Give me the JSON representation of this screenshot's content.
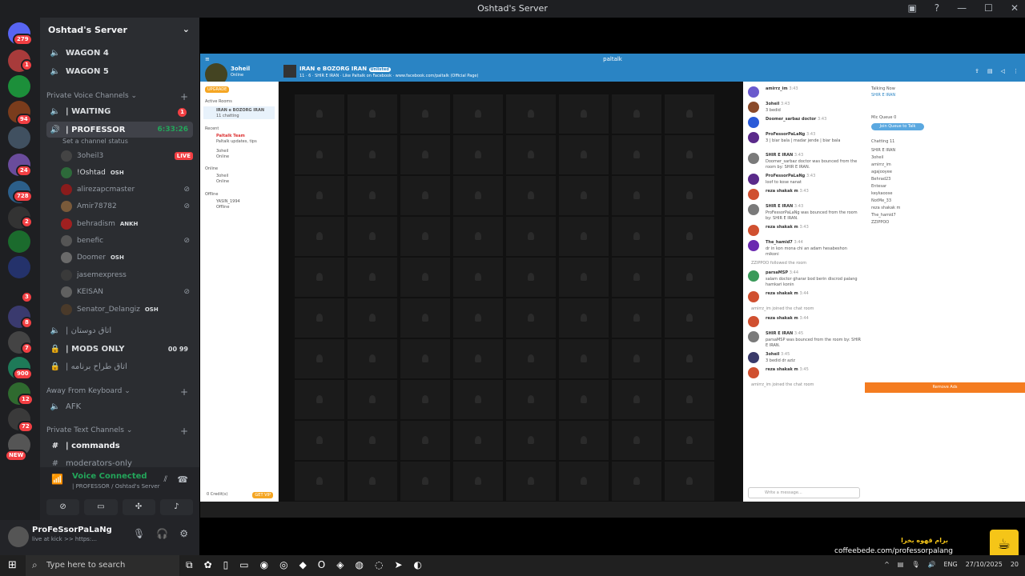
{
  "window": {
    "title": "Oshtad's Server"
  },
  "rail": {
    "badges": [
      "279",
      "1",
      "94",
      "24",
      "728",
      "2",
      "3",
      "8",
      "7",
      "900",
      "12",
      "72"
    ],
    "new_label": "NEW"
  },
  "server": {
    "name": "Oshtad's Server"
  },
  "channels": {
    "wagon4": "WAGON 4",
    "wagon5": "WAGON 5",
    "private_voice_category": "Private Voice Channels",
    "waiting": "| WAITING",
    "waiting_badge": "1",
    "professor": "| PROFESSOR",
    "professor_timer": "6:33:26",
    "set_status": "Set a channel status",
    "lounge": "| اتاق دوستان",
    "mods_only": "| MODS ONLY",
    "mods_count_a": "00",
    "mods_count_b": "99",
    "designers": "| اتاق طراح برنامه",
    "afk_category": "Away From Keyboard",
    "afk": "AFK",
    "private_text_category": "Private Text Channels",
    "commands": "| commands",
    "moderators": "moderators-only"
  },
  "voice_users": [
    {
      "name": "3oheil3",
      "tag": "",
      "live": "LIVE"
    },
    {
      "name": "!Oshtad",
      "tag": "OSH",
      "live": ""
    },
    {
      "name": "alirezapcmaster",
      "tag": "",
      "live": ""
    },
    {
      "name": "Amir78782",
      "tag": "",
      "live": ""
    },
    {
      "name": "behradism",
      "tag": "ANKH",
      "live": ""
    },
    {
      "name": "benefic",
      "tag": "",
      "live": ""
    },
    {
      "name": "Doomer",
      "tag": "OSH",
      "live": ""
    },
    {
      "name": "jasemexpress",
      "tag": "",
      "live": ""
    },
    {
      "name": "KEISAN",
      "tag": "",
      "live": ""
    },
    {
      "name": "Senator_Delangiz",
      "tag": "OSH",
      "live": ""
    }
  ],
  "voice_panel": {
    "status": "Voice Connected",
    "location": "| PROFESSOR / Oshtad's Server"
  },
  "user_panel": {
    "name": "ProFeSsorPaLaNg",
    "status": "live at kick >> https:..."
  },
  "paltalk": {
    "brand": "paltalk",
    "user": "3oheil",
    "user_status": "Online",
    "room_title": "IRAN e BOZORG IRAN",
    "room_badge": "Unlisted",
    "room_meta": "11  ·  6  ·  SHIR E IRAN  ·  Like Paltalk on Facebook  ·  www.facebook.com/paltalk (Official Page)",
    "active_rooms_label": "Active Rooms",
    "active_room": "IRAN e BOZORG IRAN",
    "active_room_sub": "11 chatting",
    "recent_label": "Recent",
    "recent_item": "Paltalk Team",
    "recent_item_sub": "Paltalk updates, tips",
    "recent_item2": "3oheil",
    "recent_item2_sub": "Online",
    "online_label": "Online",
    "online_item": "3oheil",
    "online_item_sub": "Online",
    "offline_label": "Offline",
    "offline_item": "YASIN_1994",
    "offline_item_sub": "Offline",
    "credits": "0 Credit(s)",
    "buy_label": "GET VIP",
    "talking_now": "Talking Now",
    "talking_user": "SHIR E IRAN",
    "mic_queue": "Mic Queue",
    "mic_queue_count": "0",
    "join_queue": "Join Queue to Talk",
    "chatting_label": "Chatting",
    "chatting_count": "11",
    "chatting_users": [
      "SHIR E IRAN",
      "3oheil",
      "amirrz_im",
      "agajooyee",
      "Behrad23",
      "Entesar",
      "keykaoose",
      "NotMe_33",
      "reza shakak m",
      "The_hamid7",
      "ZZIPPOO"
    ],
    "remove_ads": "Remove Ads",
    "message_placeholder": "Write a message...",
    "messages": [
      {
        "name": "amirrz_im",
        "time": "3:43",
        "text": ""
      },
      {
        "name": "3oheil",
        "time": "3:43",
        "text": "3 bedid"
      },
      {
        "name": "Doomer_sarbaz doctor",
        "time": "3:43",
        "text": ""
      },
      {
        "name": "ProFessorPaLaNg",
        "time": "3:43",
        "text": "3 | biar bala | madar jende | biar bala"
      },
      {
        "name": "SHIR E IRAN",
        "time": "3:43",
        "text": "Doomer_sarbaz doctor was bounced from the room by: SHIR E IRAN."
      },
      {
        "name": "ProFessorPaLaNg",
        "time": "3:43",
        "text": "loof to kose nanat"
      },
      {
        "name": "reza shakak m",
        "time": "3:43",
        "text": ""
      },
      {
        "name": "SHIR E IRAN",
        "time": "3:43",
        "text": "ProFessorPaLaNg was bounced from the room by: SHIR E IRAN."
      },
      {
        "name": "reza shakak m",
        "time": "3:43",
        "text": ""
      },
      {
        "name": "The_hamid7",
        "time": "3:44",
        "text": "dr in kon mona chi an adam hesabeshon mikoni"
      },
      {
        "name": "",
        "time": "",
        "text": "ZZIPPOO followed the room"
      },
      {
        "name": "parsaMSP",
        "time": "3:44",
        "text": "salam doctor gharar bod berin discrod palang hamkari konin"
      },
      {
        "name": "reza shakak m",
        "time": "3:44",
        "text": ""
      },
      {
        "name": "",
        "time": "",
        "text": "amirrz_im joined the chat room"
      },
      {
        "name": "reza shakak m",
        "time": "3:44",
        "text": ""
      },
      {
        "name": "SHIR E IRAN",
        "time": "3:45",
        "text": "parsaMSP was bounced from the room by: SHIR E IRAN."
      },
      {
        "name": "3oheil",
        "time": "3:45",
        "text": "3 bedid dr aziz"
      },
      {
        "name": "reza shakak m",
        "time": "3:45",
        "text": ""
      },
      {
        "name": "",
        "time": "",
        "text": "amirrz_im joined the chat room"
      }
    ]
  },
  "promo": {
    "fa_line": "برام قهوه بخرا",
    "url": "coffeebede.com/professorpalang"
  },
  "taskbar": {
    "search_placeholder": "Type here to search",
    "lang": "ENG",
    "date": "27/10/2025",
    "notifications": "20"
  },
  "colors": {
    "discord_green": "#23a55a",
    "discord_red": "#f23f43",
    "paltalk_blue": "#2a84c4",
    "promo_yellow": "#f5c518"
  }
}
